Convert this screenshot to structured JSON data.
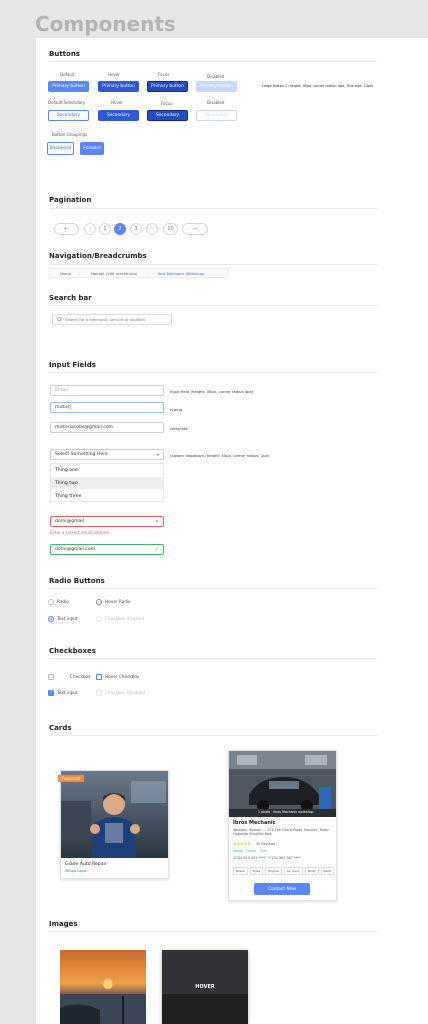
{
  "page_title": "Components",
  "buttons": {
    "title": "Buttons",
    "state_labels": [
      "Default",
      "Hover",
      "Focus",
      "Disabled"
    ],
    "primary_label": "Primary button",
    "note": "Large Button 1 (height: 45px, corner radius: 4px, Title size: 14px)",
    "secondary_state_labels": [
      "Default Secondary",
      "Hover",
      "Focus",
      "Disabled"
    ],
    "secondary_label": "Secondary",
    "groupings_title": "Button Groupings",
    "group_backward": "Backward",
    "group_forward": "Forward"
  },
  "pagination": {
    "title": "Pagination",
    "prev_icon": "←",
    "next_icon": "→",
    "items": [
      "‹",
      "1",
      "2",
      "3",
      "›",
      "10"
    ]
  },
  "breadcrumbs": {
    "title": "Navigation/Breadcrumbs",
    "items": [
      "Home",
      "Nairobi (268 mechanics)",
      "Ibra Mechanic Workshop"
    ]
  },
  "search": {
    "title": "Search bar",
    "placeholder": "Search for a mechanic, service or location"
  },
  "inputs": {
    "title": "Input Fields",
    "email_placeholder": "Email",
    "note1": "Input field (height: 45px, corner radius 4px)",
    "typing_value": "mister|",
    "typing_note": "typing",
    "complete_value": "misterjacobs@gmail.com",
    "complete_note": "complete",
    "dropdown_value": "Select Something Here",
    "dropdown_note": "custom dropdown (height: 45px, corner radius: 2px)",
    "options": [
      "Thing one",
      "Thing two",
      "Thing three"
    ],
    "error_value": "domi@gmail",
    "error_message": "Enter a correct email address",
    "valid_value": "domi@gmail.com"
  },
  "radios": {
    "title": "Radio Buttons",
    "labels": [
      "Radio",
      "Hover Radio",
      "Text input",
      "Checkbox disabled"
    ]
  },
  "checkboxes": {
    "title": "Checkboxes",
    "labels": [
      "Checkbox",
      "Hover Checkbox",
      "Text input",
      "Checkbox Disabled"
    ]
  },
  "cards": {
    "title": "Cards",
    "card1": {
      "badge": "Featured",
      "name": "Glade Auto Repair",
      "meta": "Mfupa Lapic"
    },
    "card2": {
      "caption": "1 photo · Ibros Mechanic workshop",
      "name": "Ibros Mechanic",
      "address": "Igbogbo, Ikorodu — 201 The Grace Plaza, Ikorodu · Road Opposite Shoprite Mall",
      "stars": "★★★★★",
      "reviews": "39 Reviews",
      "status": "Mostly Online · 7pm",
      "phones": "+234 810 453 **** · +234 303 567 ****",
      "tags": [
        "Brake",
        "Tyres",
        "Engine",
        "Air cond.",
        "Body",
        "Paint"
      ],
      "cta": "Contact Now"
    }
  },
  "images": {
    "title": "Images",
    "hover_label": "HOVER"
  },
  "colors": {
    "primary": "#5b87f4",
    "error": "#e85d6a",
    "success": "#3cba6b"
  }
}
